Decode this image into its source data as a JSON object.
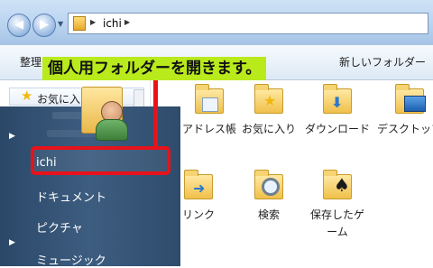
{
  "address": {
    "path_item": "ichi"
  },
  "command_bar": {
    "organize_label": "整理",
    "new_folder_label": "新しいフォルダー"
  },
  "nav_pane": {
    "favorites_label": "お気に入"
  },
  "content": {
    "items": [
      {
        "label": "アドレス帳",
        "icon": "contacts-folder-icon"
      },
      {
        "label": "お気に入り",
        "icon": "favorites-folder-icon"
      },
      {
        "label": "ダウンロード",
        "icon": "downloads-folder-icon"
      },
      {
        "label": "デスクトップ",
        "icon": "desktop-folder-icon"
      },
      {
        "label": "リンク",
        "icon": "links-folder-icon"
      },
      {
        "label": "検索",
        "icon": "searches-folder-icon"
      },
      {
        "label": "保存したゲーム",
        "icon": "saved-games-folder-icon"
      }
    ]
  },
  "start_menu": {
    "items": [
      {
        "label": "ichi"
      },
      {
        "label": "ドキュメント"
      },
      {
        "label": "ピクチャ"
      },
      {
        "label": "ミュージック"
      }
    ]
  },
  "annotation": {
    "text": "個人用フォルダーを開きます。",
    "color": "#b9ea1c",
    "highlight_color": "#e8121b"
  }
}
